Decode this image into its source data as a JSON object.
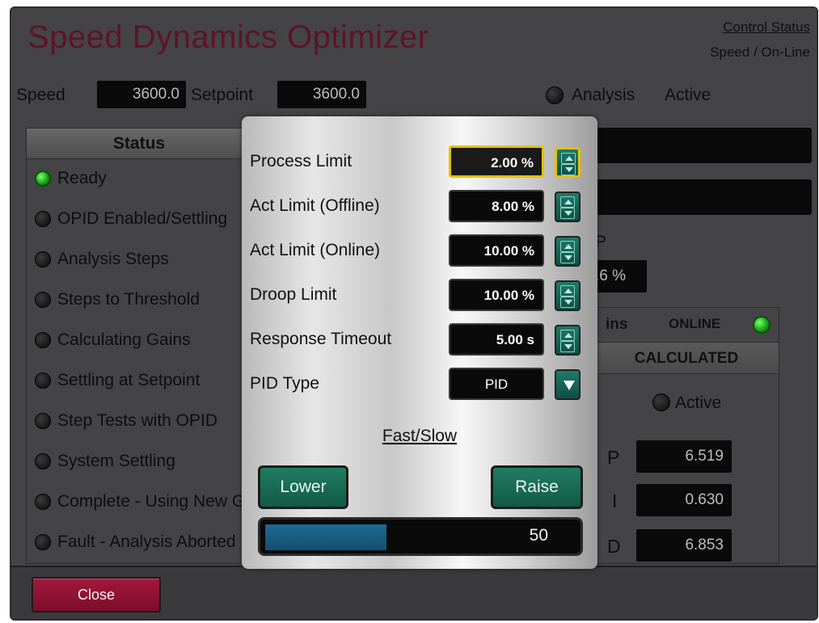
{
  "title": "Speed Dynamics Optimizer",
  "control_status": {
    "link": "Control Status",
    "value": "Speed / On-Line"
  },
  "top": {
    "speed_label": "Speed",
    "speed_value": "3600.0",
    "setpoint_label": "Setpoint",
    "setpoint_value": "3600.0",
    "analysis_label": "Analysis",
    "analysis_state": "Active"
  },
  "status": {
    "header": "Status",
    "items": [
      {
        "label": "Ready",
        "led": "green"
      },
      {
        "label": "OPID Enabled/Settling",
        "led": "off"
      },
      {
        "label": "Analysis Steps",
        "led": "off"
      },
      {
        "label": "Steps to Threshold",
        "led": "off"
      },
      {
        "label": "Calculating Gains",
        "led": "off"
      },
      {
        "label": "Settling at Setpoint",
        "led": "off"
      },
      {
        "label": "Step Tests with OPID",
        "led": "off"
      },
      {
        "label": "System Settling",
        "led": "off"
      },
      {
        "label": "Complete - Using New Gains",
        "led": "off"
      },
      {
        "label": "Fault - Analysis Aborted",
        "led": "off"
      }
    ]
  },
  "right": {
    "partial_label": "P",
    "partial_value": ".6 %"
  },
  "gains": {
    "title": "ins",
    "online_label": "ONLINE",
    "calculated_header": "CALCULATED",
    "active_label": "Active",
    "p_letter": "P",
    "i_letter": "I",
    "d_letter": "D",
    "p_value": "6.519",
    "i_value": "0.630",
    "d_value": "6.853"
  },
  "popup": {
    "rows": [
      {
        "label": "Process Limit",
        "value": "2.00 %"
      },
      {
        "label": "Act Limit (Offline)",
        "value": "8.00 %"
      },
      {
        "label": "Act Limit (Online)",
        "value": "10.00 %"
      },
      {
        "label": "Droop Limit",
        "value": "10.00 %"
      },
      {
        "label": "Response Timeout",
        "value": "5.00 s"
      }
    ],
    "pid_type_label": "PID Type",
    "pid_type_value": "PID",
    "fast_slow_label": "Fast/Slow",
    "lower_label": "Lower",
    "raise_label": "Raise",
    "slider_value": "50",
    "slider_fraction": 0.39
  },
  "close_label": "Close",
  "colors": {
    "title": "#5e1327",
    "close_button": "#8f1236",
    "action_button": "#1a6e55",
    "slider_fill": "#1e6b94",
    "led_on": "#17a81c",
    "selected_outline": "#e6c100"
  }
}
